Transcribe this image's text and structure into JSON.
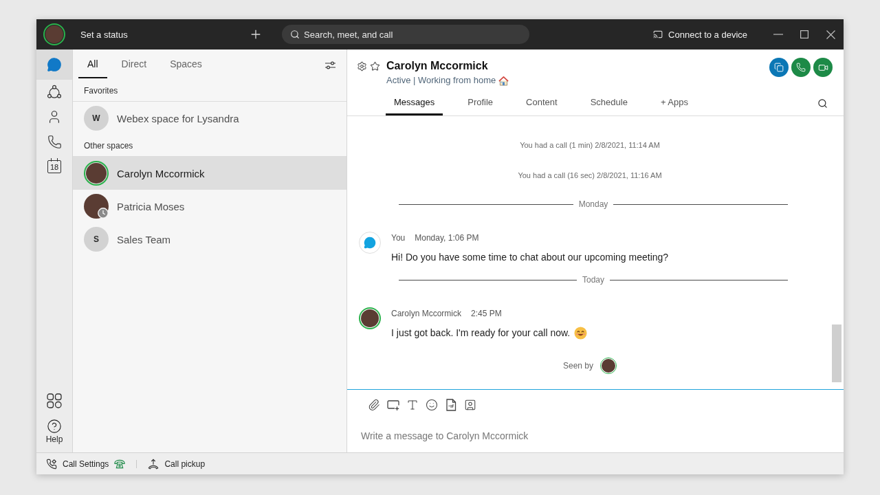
{
  "title_bar": {
    "user_avatar": {
      "kind": "photo",
      "active": true,
      "away": false
    },
    "status_label": "Set a status",
    "search": {
      "placeholder": "Search, meet, and call"
    },
    "device_button": "Connect to a device"
  },
  "nav_rail": {
    "items": [
      {
        "kind": "messaging",
        "selected": true
      },
      {
        "kind": "teams",
        "selected": false
      },
      {
        "kind": "contacts",
        "selected": false
      },
      {
        "kind": "calling",
        "selected": false
      },
      {
        "kind": "calendar",
        "selected": false,
        "text": "18"
      }
    ],
    "bottom_items": [
      {
        "kind": "apps"
      },
      {
        "kind": "help",
        "label": "Help"
      }
    ]
  },
  "space_list": {
    "tabs": [
      {
        "label": "All",
        "selected": true
      },
      {
        "label": "Direct",
        "selected": false
      },
      {
        "label": "Spaces",
        "selected": false
      }
    ],
    "sections": [
      {
        "title": "Favorites",
        "items": [
          {
            "name": "Webex space for Lysandra",
            "selected": false,
            "avatar": {
              "kind": "initial",
              "text": "W"
            }
          }
        ]
      },
      {
        "title": "Other spaces",
        "items": [
          {
            "name": "Carolyn Mccormick",
            "selected": true,
            "avatar": {
              "kind": "photo",
              "active": true,
              "away": false
            }
          },
          {
            "name": "Patricia Moses",
            "selected": false,
            "avatar": {
              "kind": "photo",
              "active": false,
              "away": true
            }
          },
          {
            "name": "Sales Team",
            "selected": false,
            "avatar": {
              "kind": "initial",
              "text": "S"
            }
          }
        ]
      }
    ]
  },
  "conversation": {
    "header": {
      "title": "Carolyn Mccormick",
      "status": "Active | Working from home",
      "status_icon": {
        "kind": "house"
      },
      "actions": [
        {
          "kind": "share"
        },
        {
          "kind": "audio_call"
        },
        {
          "kind": "video_call"
        }
      ]
    },
    "tabs": [
      {
        "label": "Messages",
        "selected": true
      },
      {
        "label": "Profile",
        "selected": false
      },
      {
        "label": "Content",
        "selected": false
      },
      {
        "label": "Schedule",
        "selected": false
      },
      {
        "label": "+ Apps",
        "selected": false
      }
    ],
    "messages": [
      {
        "kind": "call_log",
        "text": "You had a call (1 min) 2/8/2021, 11:14 AM"
      },
      {
        "kind": "call_log",
        "text": "You had a call (16 sec) 2/8/2021, 11:16 AM"
      },
      {
        "kind": "divider",
        "label": "Monday"
      },
      {
        "kind": "message",
        "sender": "You",
        "time": "Monday, 1:06 PM",
        "text": "Hi! Do you have some time to chat about our upcoming meeting?",
        "avatar": {
          "kind": "self"
        }
      },
      {
        "kind": "divider",
        "label": "Today"
      },
      {
        "kind": "message",
        "sender": "Carolyn Mccormick",
        "time": "2:45 PM",
        "text": "I just got back. I'm ready for your call now.",
        "trailing_icon": {
          "kind": "smiley"
        },
        "avatar": {
          "kind": "photo",
          "active": true,
          "away": false
        }
      },
      {
        "kind": "seen",
        "label": "Seen by",
        "avatar": {
          "kind": "photo",
          "active": true,
          "away": false
        }
      }
    ],
    "composer": {
      "tools": [
        {
          "kind": "attach"
        },
        {
          "kind": "screenshot"
        },
        {
          "kind": "format"
        },
        {
          "kind": "emoji"
        },
        {
          "kind": "gif"
        },
        {
          "kind": "contact_card"
        }
      ],
      "placeholder": "Write a message to Carolyn Mccormick"
    }
  },
  "status_bar": {
    "items": [
      {
        "kind": "call_settings",
        "label": "Call Settings"
      },
      {
        "kind": "call_pickup",
        "label": "Call pickup"
      }
    ]
  }
}
